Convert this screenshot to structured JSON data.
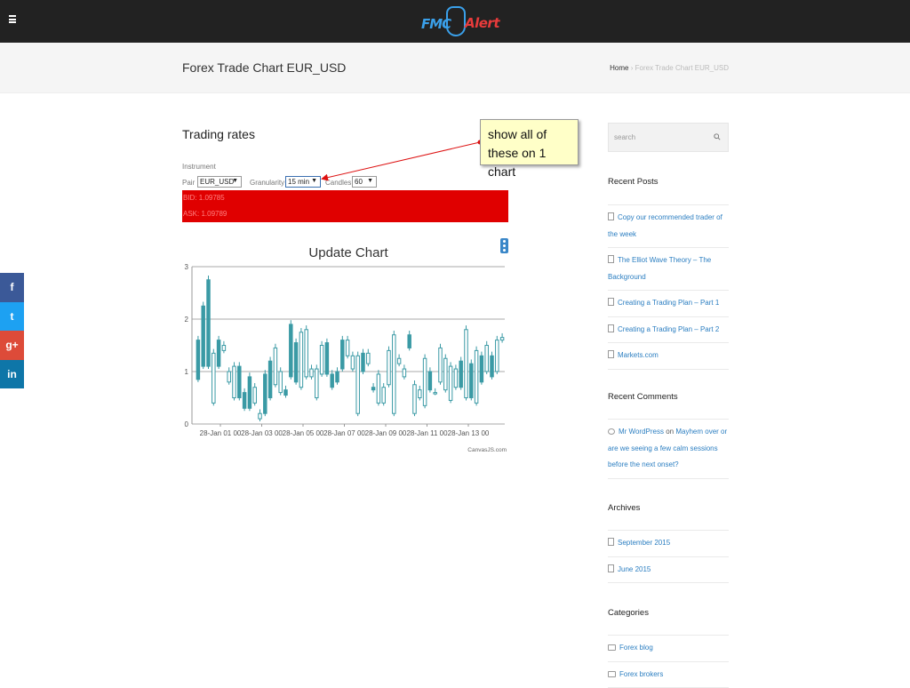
{
  "header": {
    "logo_left": "FMC",
    "logo_right": "Alert"
  },
  "titlebar": {
    "title": "Forex Trade Chart EUR_USD",
    "breadcrumb_home": "Home",
    "breadcrumb_sep": "›",
    "breadcrumb_current": "Forex Trade Chart EUR_USD"
  },
  "main": {
    "title": "Trading rates",
    "instrument_label": "Instrument",
    "pair_label": "Pair",
    "pair_value": "EUR_USD",
    "granularity_label": "Granularity",
    "granularity_value": "15 min",
    "candles_label": "Candles",
    "candles_value": "60",
    "bid": "BID: 1.09785",
    "ask": "ASK: 1.09789",
    "annotation": "show all of these on 1 chart"
  },
  "social": [
    "f",
    "t",
    "g+",
    "in"
  ],
  "social_colors": [
    "#3b5998",
    "#1da1f2",
    "#dd4b39",
    "#0e76a8"
  ],
  "sidebar": {
    "search_placeholder": "search",
    "recent_posts_title": "Recent Posts",
    "recent_posts": [
      "Copy our recommended trader of the week",
      "The Elliot Wave Theory – The Background",
      "Creating a Trading Plan – Part 1",
      "Creating a Trading Plan – Part 2",
      "Markets.com"
    ],
    "recent_comments_title": "Recent Comments",
    "comment_author": "Mr WordPress",
    "comment_on": "on",
    "comment_post": "Mayhem over or are we seeing a few calm sessions before the next onset?",
    "archives_title": "Archives",
    "archives": [
      "September 2015",
      "June 2015"
    ],
    "categories_title": "Categories",
    "categories": [
      "Forex blog",
      "Forex brokers"
    ]
  },
  "chart_data": {
    "type": "candlestick",
    "title": "Update Chart",
    "credit": "CanvasJS.com",
    "ylim": [
      0,
      3
    ],
    "yticks": [
      0,
      1,
      2,
      3
    ],
    "xticks": [
      "28-Jan 01 00",
      "28-Jan 03 00",
      "28-Jan 05 00",
      "28-Jan 07 00",
      "28-Jan 09 00",
      "28-Jan 11 00",
      "28-Jan 13 00"
    ],
    "grid": true,
    "colors": {
      "up": "#3a9aa5",
      "down": "#3a9aa5",
      "grid": "#aaaaaa"
    },
    "candles": [
      [
        0.85,
        1.6,
        1.6,
        0.85
      ],
      [
        1.1,
        2.25,
        2.25,
        1.1
      ],
      [
        1.1,
        2.75,
        2.75,
        1.1
      ],
      [
        0.4,
        1.35,
        0.4,
        1.35
      ],
      [
        1.1,
        1.6,
        1.6,
        1.1
      ],
      [
        1.4,
        1.5,
        1.4,
        1.5
      ],
      [
        0.8,
        1.0,
        0.8,
        1.0
      ],
      [
        0.5,
        1.1,
        0.5,
        1.1
      ],
      [
        0.5,
        1.1,
        1.1,
        0.5
      ],
      [
        0.3,
        0.6,
        0.6,
        0.3
      ],
      [
        0.3,
        0.9,
        0.9,
        0.3
      ],
      [
        0.4,
        0.7,
        0.4,
        0.7
      ],
      [
        0.1,
        0.2,
        0.1,
        0.2
      ],
      [
        0.2,
        0.95,
        0.95,
        0.2
      ],
      [
        0.5,
        1.2,
        1.2,
        0.5
      ],
      [
        0.75,
        1.45,
        0.75,
        1.45
      ],
      [
        0.6,
        1.0,
        0.6,
        1.0
      ],
      [
        0.55,
        0.65,
        0.65,
        0.55
      ],
      [
        0.9,
        1.9,
        1.9,
        0.9
      ],
      [
        0.8,
        1.55,
        1.55,
        0.8
      ],
      [
        0.7,
        1.75,
        0.7,
        1.75
      ],
      [
        0.9,
        1.8,
        0.9,
        1.8
      ],
      [
        0.9,
        1.05,
        0.9,
        1.05
      ],
      [
        0.5,
        1.05,
        0.5,
        1.05
      ],
      [
        0.95,
        1.5,
        0.95,
        1.5
      ],
      [
        0.95,
        1.55,
        1.55,
        0.95
      ],
      [
        0.7,
        0.95,
        0.95,
        0.7
      ],
      [
        0.8,
        1.0,
        1.0,
        0.8
      ],
      [
        1.05,
        1.6,
        1.6,
        1.05
      ],
      [
        1.3,
        1.6,
        1.3,
        1.6
      ],
      [
        1.05,
        1.3,
        1.05,
        1.3
      ],
      [
        0.2,
        1.3,
        0.2,
        1.3
      ],
      [
        1.0,
        1.35,
        1.35,
        1.0
      ],
      [
        1.15,
        1.35,
        1.15,
        1.35
      ],
      [
        0.65,
        0.7,
        0.7,
        0.65
      ],
      [
        0.4,
        0.95,
        0.4,
        0.95
      ],
      [
        0.4,
        0.7,
        0.4,
        0.7
      ],
      [
        0.75,
        1.4,
        0.75,
        1.4
      ],
      [
        0.2,
        1.7,
        0.2,
        1.7
      ],
      [
        1.15,
        1.25,
        1.15,
        1.25
      ],
      [
        0.9,
        1.05,
        0.9,
        1.05
      ],
      [
        1.45,
        1.7,
        1.7,
        1.45
      ],
      [
        0.2,
        0.75,
        0.2,
        0.75
      ],
      [
        0.5,
        0.65,
        0.5,
        0.65
      ],
      [
        0.35,
        1.25,
        0.35,
        1.25
      ],
      [
        0.65,
        1.0,
        1.0,
        0.65
      ],
      [
        0.6,
        0.6,
        0.6,
        0.6
      ],
      [
        0.8,
        1.45,
        0.8,
        1.45
      ],
      [
        0.65,
        1.25,
        0.65,
        1.25
      ],
      [
        0.45,
        1.1,
        0.45,
        1.1
      ],
      [
        0.7,
        1.05,
        0.7,
        1.05
      ],
      [
        0.7,
        1.2,
        1.2,
        0.7
      ],
      [
        0.5,
        1.8,
        0.5,
        1.8
      ],
      [
        0.5,
        1.15,
        1.15,
        0.5
      ],
      [
        0.4,
        1.4,
        0.4,
        1.4
      ],
      [
        0.8,
        1.3,
        1.3,
        0.8
      ],
      [
        1.0,
        1.5,
        1.0,
        1.5
      ],
      [
        0.9,
        1.3,
        1.3,
        0.9
      ],
      [
        1.0,
        1.6,
        1.0,
        1.6
      ],
      [
        1.6,
        1.65,
        1.6,
        1.65
      ]
    ]
  }
}
